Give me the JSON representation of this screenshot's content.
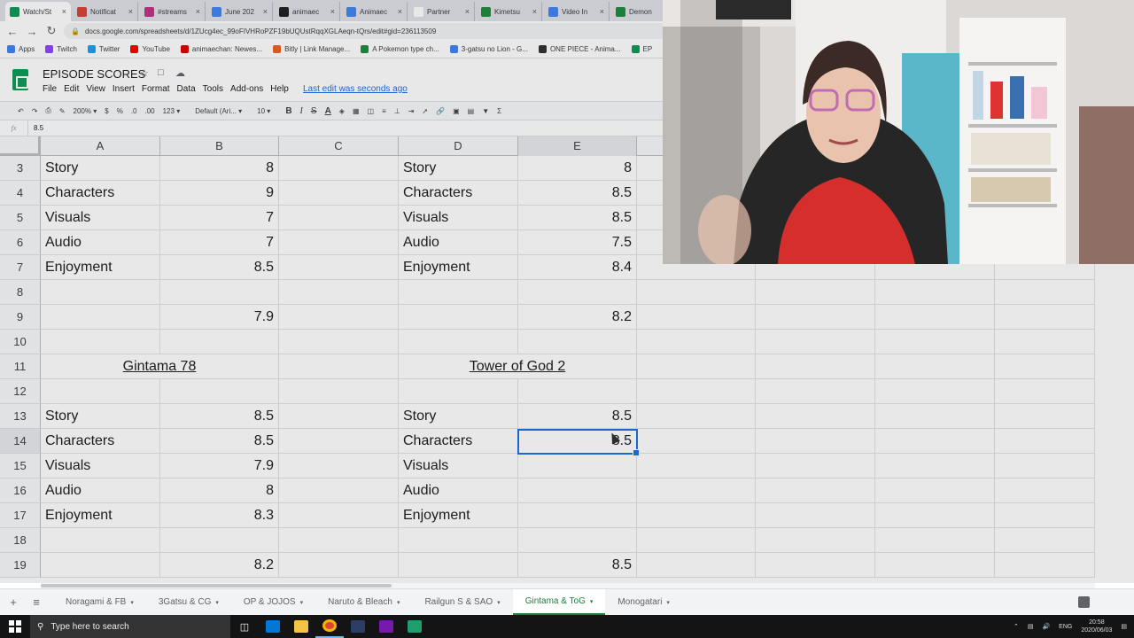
{
  "browser": {
    "tabs": [
      {
        "label": "Watch/St",
        "color": "#0f9d58"
      },
      {
        "label": "Notificat",
        "color": "#db4437"
      },
      {
        "label": "#streams",
        "color": "#c13584"
      },
      {
        "label": "June 202",
        "color": "#4285f4"
      },
      {
        "label": "animaec",
        "color": "#222222"
      },
      {
        "label": "Animaec",
        "color": "#4285f4"
      },
      {
        "label": "Partner",
        "color": "#ffffff"
      },
      {
        "label": "Kimetsu",
        "color": "#1e8e3e"
      },
      {
        "label": "Video In",
        "color": "#4285f4"
      },
      {
        "label": "Demon",
        "color": "#1e8e3e"
      }
    ],
    "url": "docs.google.com/spreadsheets/d/1ZUcg4ec_99oFIVHRoPZF19bUQUstRqqXGLAeqn-tQrs/edit#gid=236113509",
    "bookmarks": [
      {
        "label": "Apps",
        "color": "#4285f4"
      },
      {
        "label": "Twitch",
        "color": "#9146ff"
      },
      {
        "label": "Twitter",
        "color": "#1da1f2"
      },
      {
        "label": "YouTube",
        "color": "#ff0000"
      },
      {
        "label": "animaechan: Newes...",
        "color": "#e00000"
      },
      {
        "label": "Bitly | Link Manage...",
        "color": "#ee6123"
      },
      {
        "label": "A Pokemon type ch...",
        "color": "#1e8e3e"
      },
      {
        "label": "3-gatsu no Lion - G...",
        "color": "#4285f4"
      },
      {
        "label": "ONE PIECE - Anima...",
        "color": "#333333"
      },
      {
        "label": "EP",
        "color": "#0f9d58"
      }
    ]
  },
  "sheets": {
    "doc_title": "EPISODE SCORES",
    "menus": [
      "File",
      "Edit",
      "View",
      "Insert",
      "Format",
      "Data",
      "Tools",
      "Add-ons",
      "Help"
    ],
    "last_edit": "Last edit was seconds ago",
    "toolbar": {
      "zoom": "200%",
      "currency": "$",
      "percent": "%",
      "dec_less": ".0",
      "dec_more": ".00",
      "num_format": "123",
      "font": "Default (Ari...",
      "font_size": "10",
      "bold": "B",
      "italic": "I",
      "strike": "S",
      "text_color": "A"
    },
    "formula_label": "fx",
    "formula_value": "8.5",
    "columns": [
      "A",
      "B",
      "C",
      "D",
      "E"
    ],
    "rows": [
      {
        "n": "3",
        "a": "Story",
        "b": "8",
        "d": "Story",
        "e": "8"
      },
      {
        "n": "4",
        "a": "Characters",
        "b": "9",
        "d": "Characters",
        "e": "8.5"
      },
      {
        "n": "5",
        "a": "Visuals",
        "b": "7",
        "d": "Visuals",
        "e": "8.5"
      },
      {
        "n": "6",
        "a": "Audio",
        "b": "7",
        "d": "Audio",
        "e": "7.5"
      },
      {
        "n": "7",
        "a": "Enjoyment",
        "b": "8.5",
        "d": "Enjoyment",
        "e": "8.4"
      },
      {
        "n": "8",
        "a": "",
        "b": "",
        "d": "",
        "e": ""
      },
      {
        "n": "9",
        "a": "",
        "b": "7.9",
        "d": "",
        "e": "8.2"
      },
      {
        "n": "10",
        "a": "",
        "b": "",
        "d": "",
        "e": ""
      },
      {
        "n": "11",
        "title_left": "Gintama 78",
        "title_right": "Tower of God 2"
      },
      {
        "n": "12",
        "a": "",
        "b": "",
        "d": "",
        "e": ""
      },
      {
        "n": "13",
        "a": "Story",
        "b": "8.5",
        "d": "Story",
        "e": "8.5"
      },
      {
        "n": "14",
        "a": "Characters",
        "b": "8.5",
        "d": "Characters",
        "e": "8.5"
      },
      {
        "n": "15",
        "a": "Visuals",
        "b": "7.9",
        "d": "Visuals",
        "e": ""
      },
      {
        "n": "16",
        "a": "Audio",
        "b": "8",
        "d": "Audio",
        "e": ""
      },
      {
        "n": "17",
        "a": "Enjoyment",
        "b": "8.3",
        "d": "Enjoyment",
        "e": ""
      },
      {
        "n": "18",
        "a": "",
        "b": "",
        "d": "",
        "e": ""
      },
      {
        "n": "19",
        "a": "",
        "b": "8.2",
        "d": "",
        "e": "8.5"
      }
    ],
    "sheet_tabs": [
      "Noragami & FB",
      "3Gatsu & CG",
      "OP & JOJOS",
      "Naruto & Bleach",
      "Railgun S & SAO",
      "Gintama & ToG",
      "Monogatari"
    ],
    "active_sheet": "Gintama & ToG"
  },
  "taskbar": {
    "search_placeholder": "Type here to search",
    "lang": "ENG",
    "time": "20:58",
    "date": "2020/06/03"
  }
}
